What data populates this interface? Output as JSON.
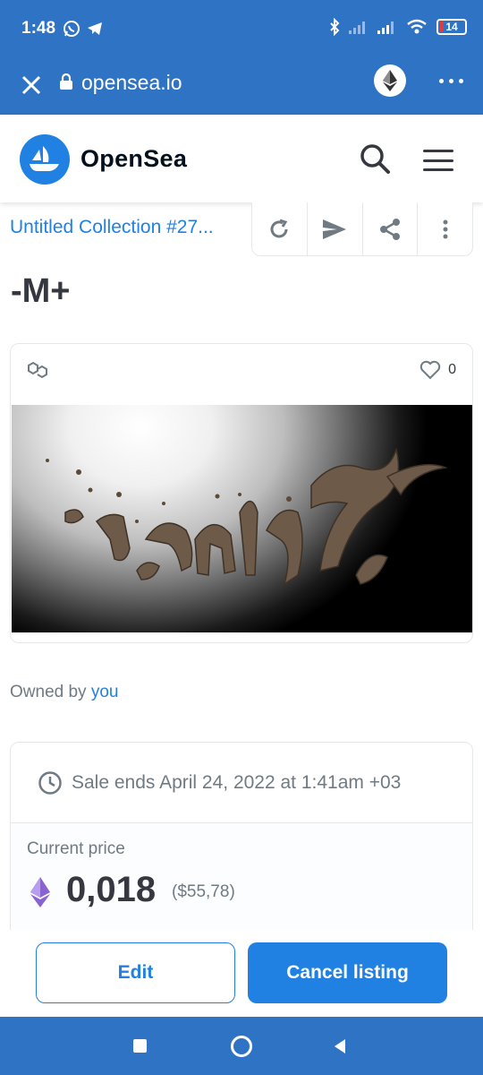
{
  "status_bar": {
    "time": "1:48",
    "battery": "14"
  },
  "browser": {
    "url": "opensea.io"
  },
  "site": {
    "name": "OpenSea"
  },
  "item": {
    "collection": "Untitled Collection #27...",
    "title": "-M+",
    "favorites": "0",
    "owned_by_label": "Owned by",
    "owner": "you"
  },
  "sale": {
    "ends_text": "Sale ends April 24, 2022 at 1:41am +03",
    "current_price_label": "Current price",
    "price": "0,018",
    "price_usd": "($55,78)"
  },
  "buttons": {
    "edit": "Edit",
    "cancel_listing": "Cancel listing"
  },
  "colors": {
    "brand": "#2081e2",
    "chrome": "#2f73c4",
    "eth_purple": "#8a63d2"
  }
}
